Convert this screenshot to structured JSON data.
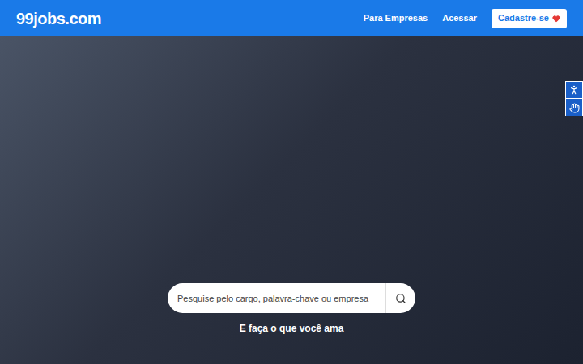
{
  "header": {
    "logo": "99jobs.com",
    "nav": [
      {
        "label": "Para Empresas"
      },
      {
        "label": "Acessar"
      }
    ],
    "signup_button": {
      "label": "Cadastre-se"
    }
  },
  "hero": {
    "search": {
      "placeholder": "Pesquise pelo cargo, palavra-chave ou empresa"
    },
    "tagline": "E faça o que você ama"
  }
}
